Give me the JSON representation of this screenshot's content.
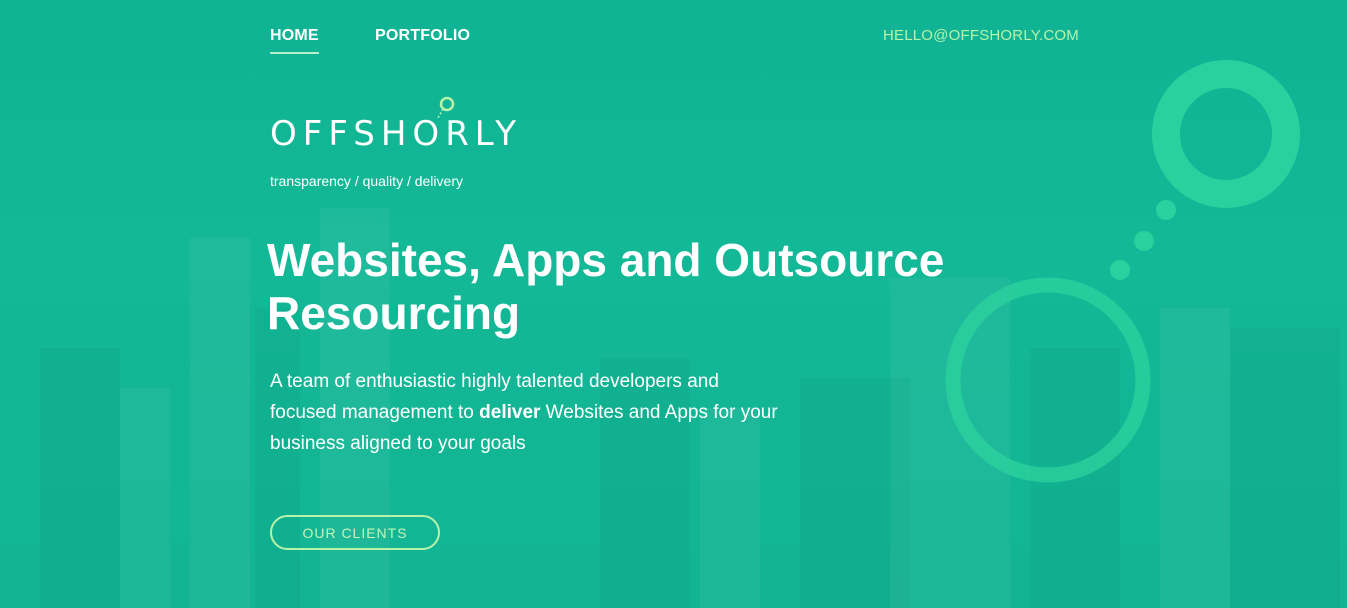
{
  "nav": {
    "home_label": "HOME",
    "portfolio_label": "PORTFOLIO",
    "email": "HELLO@OFFSHORLY.COM"
  },
  "brand": {
    "logo_text": "OFFSHORLY",
    "tagline": "transparency / quality / delivery"
  },
  "hero": {
    "headline": "Websites, Apps and Outsource Resourcing",
    "description_before": "A team of enthusiastic highly talented developers and focused management to ",
    "description_bold": "deliver",
    "description_after": " Websites and Apps for your business aligned to your goals",
    "cta_label": "OUR CLIENTS"
  },
  "colors": {
    "background": "#10b596",
    "accent_green": "#b8f3a9",
    "ring": "#2ed39e"
  },
  "icons": {
    "logo_ring": "ring-icon",
    "decoration": "bubble-rings"
  }
}
